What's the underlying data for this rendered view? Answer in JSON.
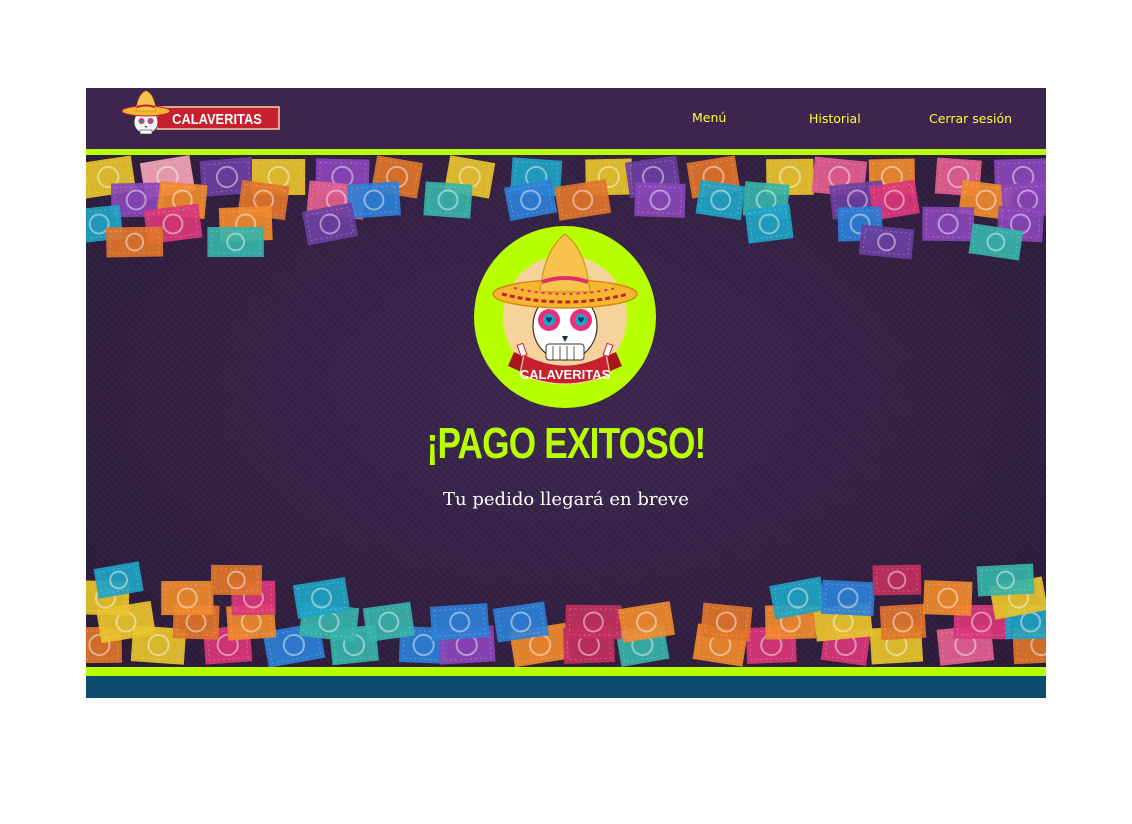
{
  "brand": {
    "name": "CALAVERITAS",
    "badge_text": "CALAVERITAS"
  },
  "nav": {
    "items": [
      {
        "label": "Menú"
      },
      {
        "label": "Historial"
      },
      {
        "label": "Cerrar sesión"
      }
    ]
  },
  "main": {
    "title": "¡PAGO EXITOSO!",
    "subtitle": "Tu pedido llegará en breve"
  },
  "colors": {
    "header_bg": "#3d2550",
    "accent_green": "#b5ff00",
    "nav_text": "#ffff33",
    "footer_bg": "#0b4c6e",
    "brand_red": "#c8202f"
  },
  "icons": {
    "logo": "sombrero-skull-icon",
    "badge": "sugar-skull-badge-icon",
    "decoration": "papel-picado-banners"
  }
}
